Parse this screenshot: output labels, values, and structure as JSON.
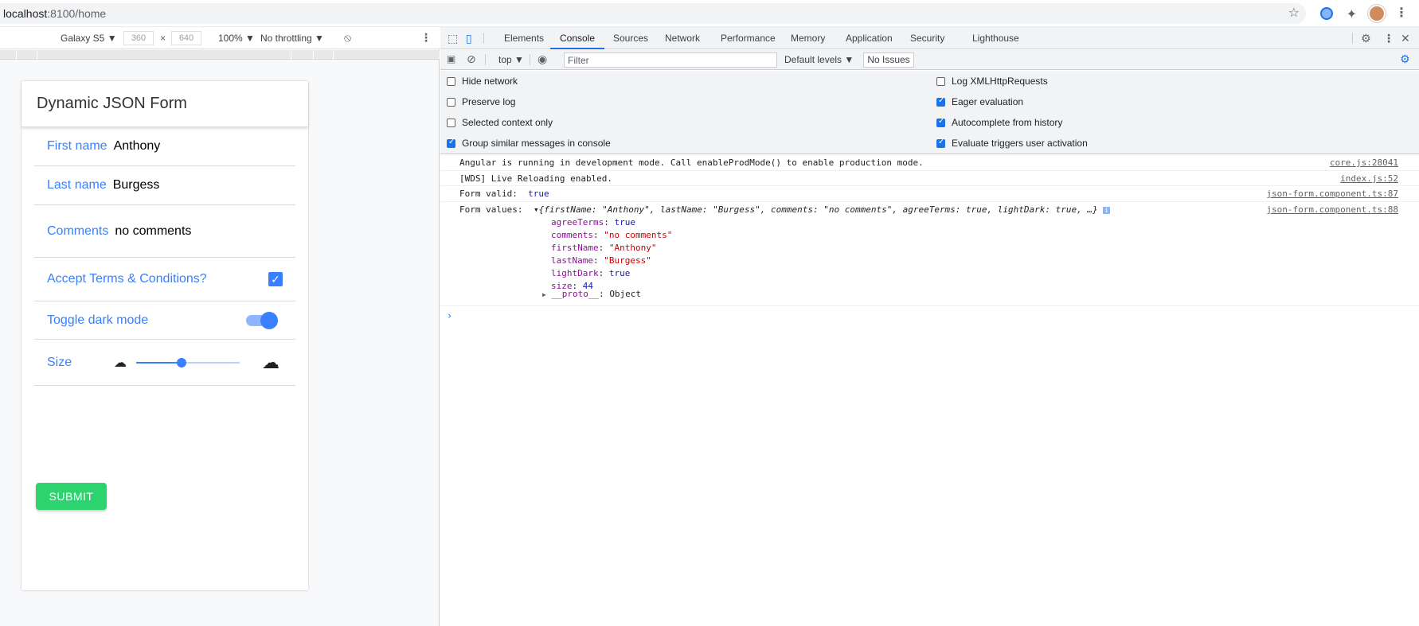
{
  "browser": {
    "url_host": "localhost",
    "url_path": ":8100/home"
  },
  "device_toolbar": {
    "device": "Galaxy S5 ▼",
    "width": "360",
    "height": "640",
    "times": "×",
    "zoom": "100% ▼",
    "throttle": "No throttling ▼"
  },
  "app": {
    "title": "Dynamic JSON Form",
    "first_name_label": "First name",
    "first_name_value": "Anthony",
    "last_name_label": "Last name",
    "last_name_value": "Burgess",
    "comments_label": "Comments",
    "comments_value": "no comments",
    "terms_label": "Accept Terms & Conditions?",
    "terms_checked": true,
    "dark_label": "Toggle dark mode",
    "dark_on": true,
    "size_label": "Size",
    "size_value_fraction": 0.44,
    "submit_label": "SUBMIT"
  },
  "devtools": {
    "tabs": [
      "Elements",
      "Console",
      "Sources",
      "Network",
      "Performance",
      "Memory",
      "Application",
      "Security",
      "Lighthouse"
    ],
    "active_tab": "Console",
    "context": "top ▼",
    "filter_placeholder": "Filter",
    "levels": "Default levels ▼",
    "issues": "No Issues",
    "options_left": [
      "Hide network",
      "Preserve log",
      "Selected context only",
      "Group similar messages in console"
    ],
    "options_left_checked": [
      false,
      false,
      false,
      true
    ],
    "options_right": [
      "Log XMLHttpRequests",
      "Eager evaluation",
      "Autocomplete from history",
      "Evaluate triggers user activation"
    ],
    "options_right_checked": [
      false,
      true,
      true,
      true
    ]
  },
  "console": {
    "msg1": "Angular is running in development mode. Call enableProdMode() to enable production mode.",
    "msg1_src": "core.js:28041",
    "msg2": "[WDS] Live Reloading enabled.",
    "msg2_src": "index.js:52",
    "msg3_label": "Form valid: ",
    "msg3_value": "true",
    "msg3_src": "json-form.component.ts:87",
    "msg4_label": "Form values: ",
    "msg4_src": "json-form.component.ts:88",
    "obj_preview": "{firstName: \"Anthony\", lastName: \"Burgess\", comments: \"no comments\", agreeTerms: true, lightDark: true, …}",
    "props": [
      {
        "key": "agreeTerms",
        "value": "true",
        "kind": "bool"
      },
      {
        "key": "comments",
        "value": "\"no comments\"",
        "kind": "str"
      },
      {
        "key": "firstName",
        "value": "\"Anthony\"",
        "kind": "str"
      },
      {
        "key": "lastName",
        "value": "\"Burgess\"",
        "kind": "str"
      },
      {
        "key": "lightDark",
        "value": "true",
        "kind": "bool"
      },
      {
        "key": "size",
        "value": "44",
        "kind": "num"
      }
    ],
    "proto": "__proto__",
    "proto_value": "Object"
  }
}
